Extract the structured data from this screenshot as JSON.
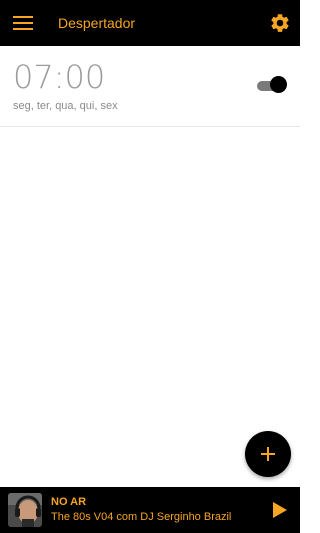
{
  "app": {
    "title": "Despertador",
    "accent": "#f5a623",
    "bar_background": "#000000"
  },
  "icons": {
    "menu": "hamburger-menu-icon",
    "settings": "gear-icon",
    "add": "plus-icon",
    "play": "play-icon"
  },
  "alarms": [
    {
      "time": "07:00",
      "days": "seg, ter, qua, qui, sex",
      "enabled": true
    }
  ],
  "player": {
    "status_label": "NO AR",
    "track_title": "The 80s V04 com DJ Serginho Brazil"
  }
}
